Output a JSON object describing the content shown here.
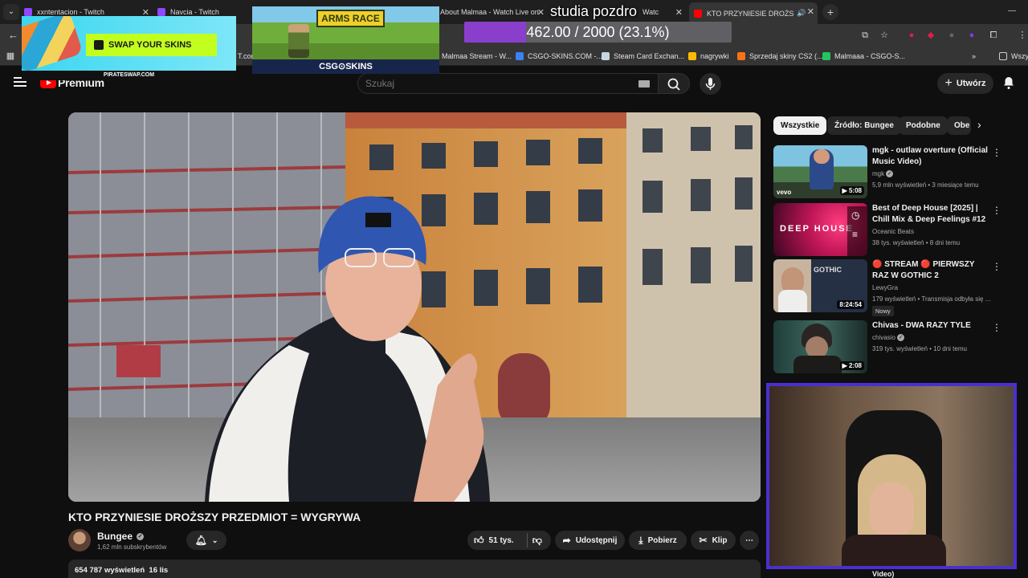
{
  "browser": {
    "tabs": [
      {
        "title": "xxntentacion - Twitch",
        "color": "#9146ff"
      },
      {
        "title": "Navcia - Twitch",
        "color": "#9146ff"
      },
      {
        "title": "About Malmaa - Watch Live on",
        "color": "#ff0000"
      },
      {
        "title": "Watc",
        "color": "#ff0000"
      },
      {
        "title": "KTO PRZYNIESIE DROŻSZY",
        "color": "#ff0000"
      }
    ],
    "bookmarks": [
      {
        "label": "Malmaa Stream - W...",
        "color": "#ff0000"
      },
      {
        "label": "CSGO-SKINS.COM -...",
        "color": "#3b82f6"
      },
      {
        "label": "Steam Card Exchan...",
        "color": "#1b2838"
      },
      {
        "label": "nagrywki",
        "color": "#fbbc04"
      },
      {
        "label": "Sprzedaj skiny CS2 (...",
        "color": "#f97316"
      },
      {
        "label": "Malmaaa - CSGO-S...",
        "color": "#22c55e"
      }
    ],
    "other_bookmarks": "Wszy",
    "stub_text": "T.com"
  },
  "youtube": {
    "brand": "Premium",
    "search_placeholder": "Szukaj",
    "create_label": "Utwórz",
    "video": {
      "title": "KTO PRZYNIESIE DROŻSZY PRZEDMIOT = WYGRYWA",
      "channel": "Bungee",
      "subscribers": "1,62 mln subskrybentów",
      "likes": "51 tys.",
      "share": "Udostępnij",
      "download": "Pobierz",
      "clip": "Klip",
      "views": "654 787 wyświetleń",
      "date": "16 lis"
    },
    "chips": [
      "Wszystkie",
      "Źródło: Bungee",
      "Podobne",
      "Obe"
    ],
    "recommendations": [
      {
        "title": "mgk - outlaw overture (Official Music Video)",
        "channel": "mgk",
        "verified": true,
        "meta": "5,9 mln wyświetleń • 3 miesiące temu",
        "duration": "5:08",
        "badge": "vevo"
      },
      {
        "title": "Best of Deep House [2025] | Chill Mix & Deep Feelings #12",
        "channel": "Oceanic Beats",
        "verified": false,
        "meta": "38 tys. wyświetleń • 8 dni temu",
        "duration": "",
        "badge": "DEEP HOUSE"
      },
      {
        "title": "🔴 STREAM 🔴 PIERWSZY RAZ W GOTHIC 2",
        "channel": "LewyGra",
        "verified": false,
        "meta": "179 wyświetleń • Transmisja odbyła się ...",
        "duration": "8:24:54",
        "badge": "Nowy"
      },
      {
        "title": "Chivas - DWA RAZY TYLE",
        "channel": "chivasio",
        "verified": true,
        "meta": "319 tys. wyświetleń • 10 dni temu",
        "duration": "2:08",
        "badge": ""
      }
    ],
    "partial_next": "Video)"
  },
  "overlay": {
    "ad1": {
      "cta": "SWAP YOUR SKINS",
      "site": "PIRATESWAP.COM"
    },
    "ad2": {
      "headline": "ARMS RACE",
      "brand": "CSG⊙SKINS"
    },
    "goal": {
      "title": "studia pozdro",
      "text": "462.00 / 2000 (23.1%)",
      "current": 462,
      "target": 2000,
      "fraction": 0.231
    }
  }
}
